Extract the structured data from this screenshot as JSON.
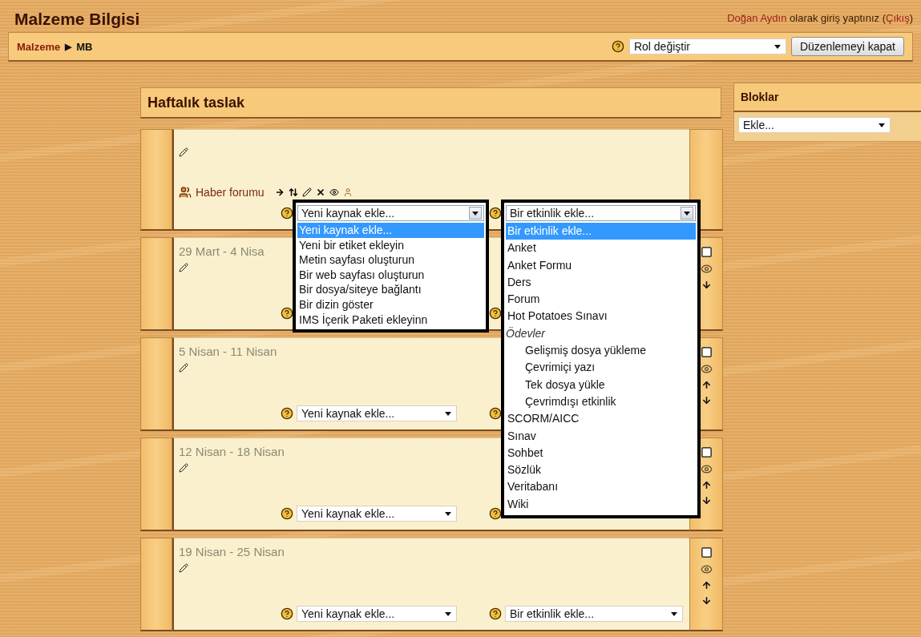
{
  "header": {
    "title": "Malzeme Bilgisi",
    "login": {
      "user": "Doğan Aydın",
      "text": "olarak giriş yaptınız",
      "open": "(",
      "logout": "Çıkış",
      "close": ")"
    }
  },
  "navbar": {
    "breadcrumb": [
      {
        "label": "Malzeme",
        "link": true
      },
      {
        "label": "MB",
        "link": false
      }
    ],
    "separator": "▶",
    "role_select": {
      "value": "Rol değiştir"
    },
    "edit_button": "Düzenlemeyi kapat"
  },
  "course": {
    "title": "Haftalık taslak",
    "sections": [
      {
        "kind": "general",
        "activities": [
          {
            "name": "Haber forumu"
          }
        ],
        "resource_select": {
          "value": "Yeni kaynak ekle...",
          "expanded": true,
          "options": [
            {
              "label": "Yeni kaynak ekle...",
              "selected": true
            },
            {
              "label": "Yeni bir etiket ekleyin",
              "selected": false
            },
            {
              "label": "Metin sayfası oluşturun",
              "selected": false
            },
            {
              "label": "Bir web sayfası oluşturun",
              "selected": false
            },
            {
              "label": "Bir dosya/siteye bağlantı",
              "selected": false
            },
            {
              "label": "Bir dizin göster",
              "selected": false
            },
            {
              "label": "IMS İçerik Paketi ekleyinn",
              "selected": false
            }
          ]
        },
        "activity_select": {
          "value": "Bir etkinlik ekle...",
          "expanded": true,
          "options": [
            {
              "label": "Bir etkinlik ekle...",
              "selected": true
            },
            {
              "label": "Anket",
              "selected": false
            },
            {
              "label": "Anket Formu",
              "selected": false
            },
            {
              "label": "Ders",
              "selected": false
            },
            {
              "label": "Forum",
              "selected": false
            },
            {
              "label": "Hot Potatoes Sınavı",
              "selected": false
            },
            {
              "label": "Ödevler",
              "kind": "group",
              "children": [
                {
                  "label": "Gelişmiş dosya yükleme",
                  "selected": false
                },
                {
                  "label": "Çevrimiçi yazı",
                  "selected": false
                },
                {
                  "label": "Tek dosya yükle",
                  "selected": false
                },
                {
                  "label": "Çevrimdışı etkinlik",
                  "selected": false
                }
              ]
            },
            {
              "label": "SCORM/AICC",
              "selected": false
            },
            {
              "label": "Sınav",
              "selected": false
            },
            {
              "label": "Sohbet",
              "selected": false
            },
            {
              "label": "Sözlük",
              "selected": false
            },
            {
              "label": "Veritabanı",
              "selected": false
            },
            {
              "label": "Wiki",
              "selected": false
            }
          ]
        }
      },
      {
        "kind": "week",
        "title": "29 Mart - 4 Nisa",
        "move_up": false,
        "move_down": true
      },
      {
        "kind": "week",
        "title": "5 Nisan - 11 Nisan",
        "move_up": true,
        "move_down": true,
        "resource_select": {
          "value": "Yeni kaynak ekle...",
          "expanded": false
        }
      },
      {
        "kind": "week",
        "title": "12 Nisan - 18 Nisan",
        "move_up": true,
        "move_down": true,
        "resource_select": {
          "value": "Yeni kaynak ekle...",
          "expanded": false
        }
      },
      {
        "kind": "week",
        "title": "19 Nisan - 25 Nisan",
        "move_up": true,
        "move_down": true,
        "resource_select": {
          "value": "Yeni kaynak ekle...",
          "expanded": false
        },
        "activity_select": {
          "value": "Bir etkinlik ekle...",
          "expanded": false
        }
      }
    ]
  },
  "blocks": {
    "title": "Bloklar",
    "add_select": {
      "value": "Ekle..."
    }
  }
}
